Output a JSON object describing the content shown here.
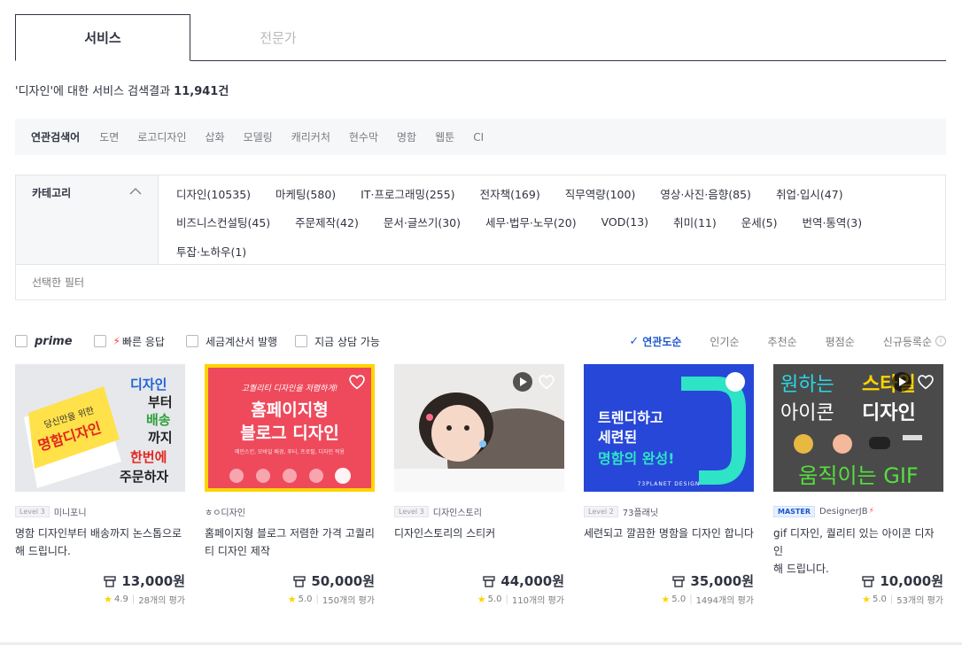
{
  "tabs": [
    {
      "label": "서비스",
      "active": true
    },
    {
      "label": "전문가",
      "active": false
    }
  ],
  "summary": {
    "query": "'디자인'에 대한 서비스 검색결과",
    "count": "11,941건"
  },
  "related": {
    "label": "연관검색어",
    "keywords": [
      "도면",
      "로고디자인",
      "삽화",
      "모델링",
      "캐리커처",
      "현수막",
      "명함",
      "웹툰",
      "CI"
    ]
  },
  "category": {
    "label": "카테고리",
    "rows": [
      [
        "디자인(10535)",
        "마케팅(580)",
        "IT·프로그래밍(255)",
        "전자책(169)",
        "직무역량(100)",
        "영상·사진·음향(85)",
        "취업·입시(47)"
      ],
      [
        "비즈니스컨설팅(45)",
        "주문제작(42)",
        "문서·글쓰기(30)",
        "세무·법무·노무(20)",
        "VOD(13)",
        "취미(11)",
        "운세(5)",
        "번역·통역(3)"
      ],
      [
        "투잡·노하우(1)"
      ]
    ],
    "selected_filter_label": "선택한 필터"
  },
  "options": {
    "prime": "prime",
    "fast": "빠른 응답",
    "tax": "세금계산서 발행",
    "consult": "지금 상담 가능"
  },
  "sorts": {
    "active": "연관도순",
    "others": [
      "인기순",
      "추천순",
      "평점순",
      "신규등록순"
    ]
  },
  "cards": [
    {
      "level": "Level 3",
      "seller": "미니포니",
      "title_line1": "명함 디자인부터 배송까지 논스톱으로",
      "title_line2": "해 드립니다.",
      "price": "13,000원",
      "rating": "4.9",
      "reviews": "28개의 평가",
      "img": {
        "t1": "당신만을 위한",
        "t2": "명함디자인",
        "r1": "디자인",
        "r2": "부터",
        "r3": "배송",
        "r4": "까지",
        "r5": "한번에",
        "r6": "주문하자"
      }
    },
    {
      "level": "",
      "seller": "ㅎㅇ디자인",
      "title_line1": "홈페이지형 블로그 저렴한 가격 고퀄리",
      "title_line2": "티 디자인 제작",
      "price": "50,000원",
      "rating": "5.0",
      "reviews": "150개의 평가",
      "img": {
        "t1": "고퀄리티 디자인을 저렴하게!",
        "t2": "홈페이지형",
        "t3": "블로그 디자인",
        "t4": "메인스킨, 모바일 배경, 푸터, 프로필, 디자인 적용"
      }
    },
    {
      "level": "Level 3",
      "seller": "디자인스토리",
      "title_line1": "디자인스토리의 스티커",
      "title_line2": "",
      "price": "44,000원",
      "rating": "5.0",
      "reviews": "110개의 평가",
      "img": {}
    },
    {
      "level": "Level 2",
      "seller": "73플래닛",
      "title_line1": "세련되고 깔끔한 명함을 디자인 합니다",
      "title_line2": "",
      "price": "35,000원",
      "rating": "5.0",
      "reviews": "1494개의 평가",
      "img": {
        "t1": "트렌디하고",
        "t2": "세련된",
        "t3": "명함의 완성!",
        "t4": "73PLANET DESIGN"
      }
    },
    {
      "level": "MASTER",
      "seller": "DesignerJB",
      "title_line1": "gif 디자인, 퀄리티 있는 아이콘 디자인",
      "title_line2": "해 드립니다.",
      "price": "10,000원",
      "rating": "5.0",
      "reviews": "53개의 평가",
      "img": {
        "t1": "원하는",
        "t2": "스타일",
        "t3": "아이콘",
        "t4": "디자인",
        "t5": "움직이는 GIF"
      }
    }
  ],
  "colors": {
    "accent": "#1e56ce",
    "text": "#303441",
    "muted": "#7b7c80",
    "star": "#ffd400"
  }
}
